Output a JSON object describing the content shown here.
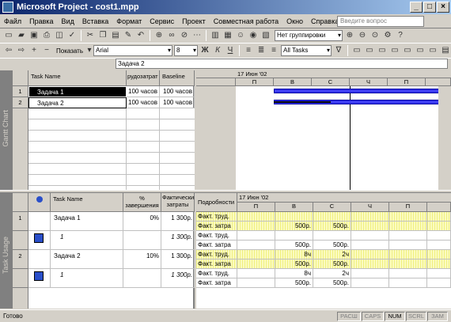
{
  "window": {
    "title": "Microsoft Project - cost1.mpp"
  },
  "menu": [
    "Файл",
    "Правка",
    "Вид",
    "Вставка",
    "Формат",
    "Сервис",
    "Проект",
    "Совместная работа",
    "Окно",
    "Справка"
  ],
  "ask_placeholder": "Введите вопрос",
  "toolbar": {
    "grouping": "Нет группировки",
    "show": "Показать",
    "font": "Arial",
    "size": "8",
    "bold": "Ж",
    "italic": "К",
    "underline": "Ч",
    "filter": "All Tasks"
  },
  "entry_value": "Задача 2",
  "gantt": {
    "label": "Gantt Chart",
    "headers": [
      "Task Name",
      "рудозатрат",
      "Baseline"
    ],
    "rows": [
      {
        "id": "1",
        "name": "Задача 1",
        "work": "100 часов",
        "baseline": "100 часов"
      },
      {
        "id": "2",
        "name": "Задача 2",
        "work": "100 часов",
        "baseline": "100 часов"
      }
    ],
    "timescale_top": "17 Июн '02",
    "days": [
      "П",
      "В",
      "С",
      "Ч",
      "П"
    ]
  },
  "usage": {
    "label": "Task Usage",
    "headers": [
      "Task Name",
      "% завершения",
      "Фактические затраты"
    ],
    "details_header": "Подробности",
    "timescale_top": "17 Июн '02",
    "days": [
      "П",
      "В",
      "С",
      "Ч",
      "П"
    ],
    "rows": [
      {
        "id": "1",
        "name": "Задача 1",
        "pct": "0%",
        "cost": "1 300р.",
        "d1": "Факт. труд.",
        "d2": "Факт. затра",
        "v_tue": "500р.",
        "v_wed": "500р.",
        "hatched": true
      },
      {
        "id": "",
        "name": "1",
        "pct": "",
        "cost": "1 300р.",
        "d1": "Факт. труд.",
        "d2": "Факт. затра",
        "v_tue": "500р.",
        "v_wed": "500р.",
        "hatched": false
      },
      {
        "id": "2",
        "name": "Задача 2",
        "pct": "10%",
        "cost": "1 300р.",
        "d1": "Факт. труд.",
        "d2": "Факт. затра",
        "w_tue": "8ч",
        "w_wed": "2ч",
        "v_tue": "500р.",
        "v_wed": "500р.",
        "hatched": true
      },
      {
        "id": "",
        "name": "1",
        "pct": "",
        "cost": "1 300р.",
        "d1": "Факт. труд.",
        "d2": "Факт. затра",
        "w_tue": "8ч",
        "w_wed": "2ч",
        "v_tue": "500р.",
        "v_wed": "500р.",
        "hatched": false
      }
    ]
  },
  "status": {
    "ready": "Готово",
    "caps_ext": "РАСШ",
    "caps": "CAPS",
    "num": "NUM",
    "scrl": "SCRL",
    "zam": "ЗАМ"
  }
}
